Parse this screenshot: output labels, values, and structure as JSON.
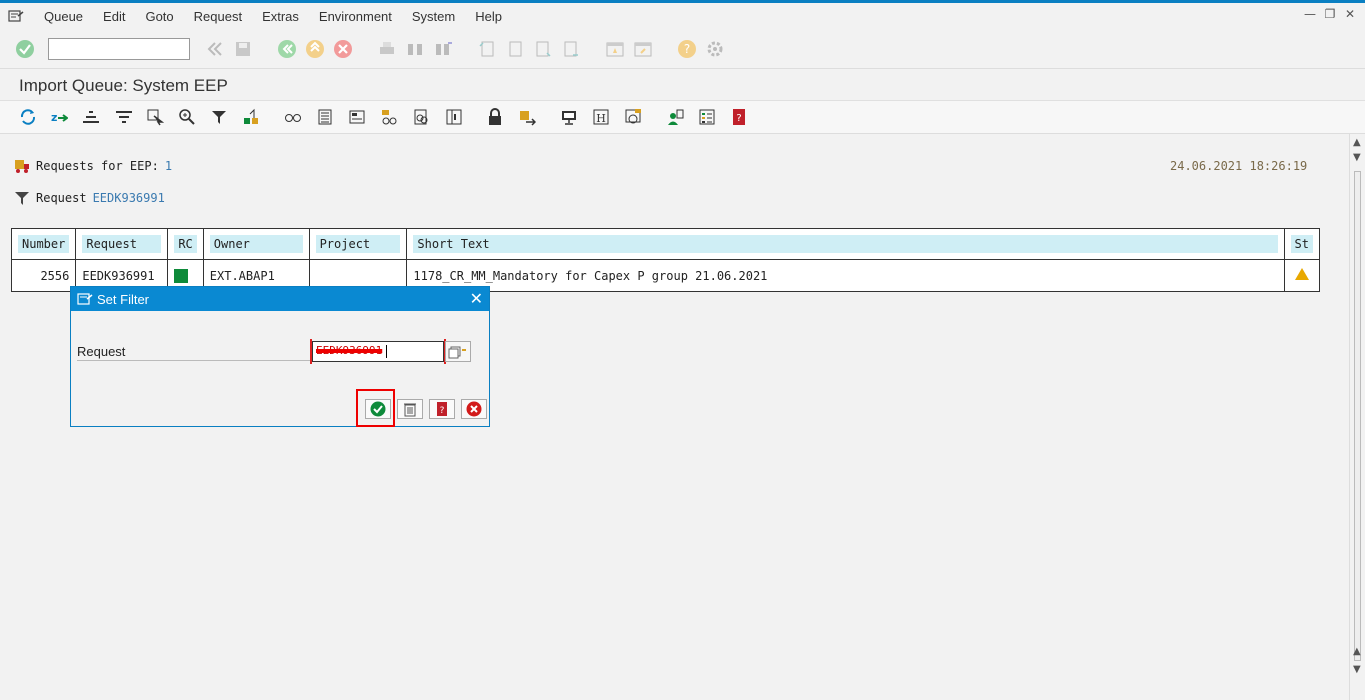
{
  "menu": [
    "Queue",
    "Edit",
    "Goto",
    "Request",
    "Extras",
    "Environment",
    "System",
    "Help"
  ],
  "window_controls": [
    "minimize-icon",
    "restore-icon",
    "close-icon"
  ],
  "toolbar": {
    "command_field_value": "",
    "icons": [
      "enter-icon",
      "back-icon",
      "save-icon",
      "back-green-icon",
      "exit-icon",
      "cancel-icon",
      "print-icon",
      "find-icon",
      "find-next-icon",
      "first-page-icon",
      "previous-page-icon",
      "next-page-icon",
      "last-page-icon",
      "create-session-icon",
      "shortcut-icon",
      "help-icon",
      "settings-icon"
    ]
  },
  "title": "Import Queue: System EEP",
  "app_toolbar_icons": [
    "refresh-icon",
    "import-icon",
    "sort-ascending-icon",
    "sort-descending-icon",
    "select-icon",
    "zoom-icon",
    "filter-icon",
    "transport-icon",
    "display-icon",
    "list-icon",
    "layout-icon",
    "tree-icon",
    "log-icon",
    "detail-icon",
    "lock-icon",
    "move-icon",
    "monitor-icon",
    "help-h-icon",
    "system-icon",
    "user-icon",
    "legend-icon",
    "book-icon"
  ],
  "info": {
    "requests_label": "Requests for EEP:",
    "requests_count": "1",
    "filter_label": "Request",
    "filter_value": "EEDK936991",
    "timestamp": "24.06.2021 18:26:19"
  },
  "table": {
    "headers": [
      "Number",
      "Request",
      "RC",
      "Owner",
      "Project",
      "Short Text",
      "St"
    ],
    "rows": [
      {
        "number": "2556",
        "request": "EEDK936991",
        "rc_color": "#0e8a3a",
        "owner": "EXT.ABAP1",
        "project": "",
        "short_text": "1178_CR_MM_Mandatory for Capex P group 21.06.2021",
        "status_icon": "warning-icon"
      }
    ]
  },
  "dialog": {
    "title": "Set Filter",
    "field_label": "Request",
    "field_value": "EEDK936991",
    "buttons": [
      "confirm-icon",
      "delete-icon",
      "help-book-icon",
      "cancel-icon"
    ]
  }
}
